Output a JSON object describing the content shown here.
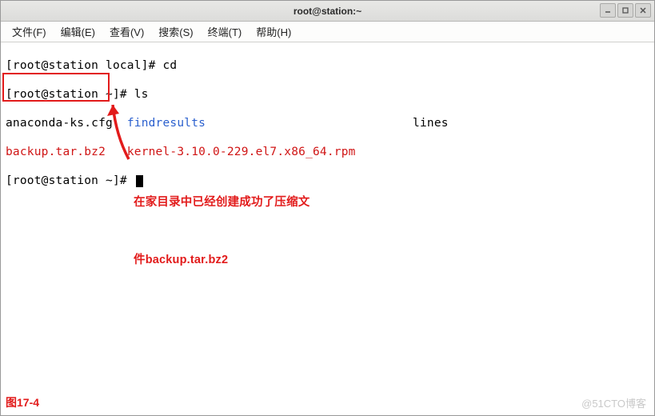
{
  "window": {
    "title": "root@station:~"
  },
  "menu": {
    "file": "文件(F)",
    "edit": "编辑(E)",
    "view": "查看(V)",
    "search": "搜索(S)",
    "terminal": "终端(T)",
    "help": "帮助(H)"
  },
  "term": {
    "line1_prompt": "[root@station local]# ",
    "line1_cmd": "cd",
    "line2_prompt": "[root@station ~]# ",
    "line2_cmd": "ls",
    "ls_row1_col1": "anaconda-ks.cfg",
    "ls_row1_gap1": "  ",
    "ls_row1_col2": "findresults",
    "ls_row1_gap2": "                             ",
    "ls_row1_col3": "lines",
    "ls_row2_col1": "backup.tar.bz2",
    "ls_row2_gap1": "   ",
    "ls_row2_col2": "kernel-3.10.0-229.el7.x86_64.rpm",
    "line5_prompt": "[root@station ~]# "
  },
  "annotation": {
    "text_l1": "在家目录中已经创建成功了压缩文",
    "text_l2": "件backup.tar.bz2"
  },
  "figure_label": "图17-4",
  "watermark": "@51CTO博客"
}
